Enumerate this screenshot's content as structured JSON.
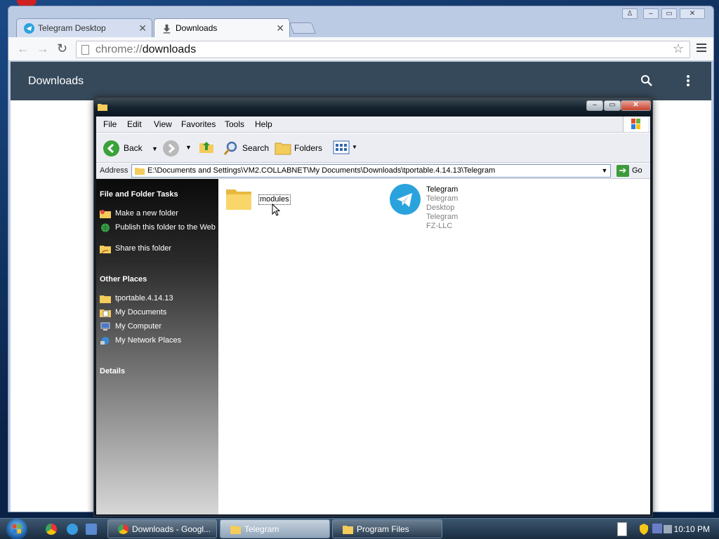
{
  "browser": {
    "tabs": [
      {
        "label": "Telegram Desktop",
        "active": false
      },
      {
        "label": "Downloads",
        "active": true
      }
    ],
    "url_scheme": "chrome://",
    "url_host": "downloads",
    "page_title": "Downloads"
  },
  "explorer": {
    "menu": [
      "File",
      "Edit",
      "View",
      "Favorites",
      "Tools",
      "Help"
    ],
    "toolbar": {
      "back": "Back",
      "search": "Search",
      "folders": "Folders"
    },
    "address_label": "Address",
    "address": "E:\\Documents and Settings\\VM2.COLLABNET\\My Documents\\Downloads\\tportable.4.14.13\\Telegram",
    "go": "Go",
    "tasks_header": "File and Folder Tasks",
    "tasks": [
      "Make a new folder",
      "Publish this folder to the Web",
      "Share this folder"
    ],
    "places_header": "Other Places",
    "places": [
      "tportable.4.14.13",
      "My Documents",
      "My Computer",
      "My Network Places"
    ],
    "details_header": "Details",
    "items": [
      {
        "name": "modules",
        "type": "folder"
      },
      {
        "name": "Telegram",
        "line2": "Telegram Desktop",
        "line3": "Telegram FZ-LLC",
        "type": "app"
      }
    ]
  },
  "taskbar": {
    "tasks": [
      "Downloads - Googl...",
      "Telegram",
      "Program Files"
    ],
    "clock": "10:10 PM"
  },
  "colors": {
    "chrome_header": "#36495a",
    "telegram_blue": "#2aa3dd",
    "folder": "#f3cc5b"
  }
}
